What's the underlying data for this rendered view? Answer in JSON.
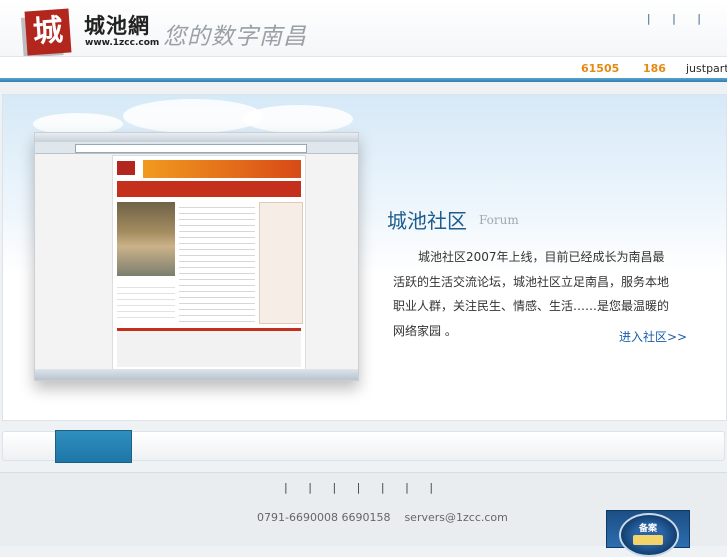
{
  "header": {
    "logo_char": "城",
    "site_name": "城池網",
    "site_url": "www.1zcc.com",
    "slogan": "您的数字南昌",
    "top_links": [
      "|",
      "|",
      "|"
    ]
  },
  "stats": {
    "users": "61505",
    "online": "186",
    "newest_member": "justparty"
  },
  "banner": {
    "title": "城池社区",
    "subtitle": "Forum",
    "description": "城池社区2007年上线，目前已经成长为南昌最活跃的生活交流论坛，城池社区立足南昌，服务本地职业人群，关注民生、情感、生活……是您最温暖的网络家园 。",
    "enter_link": "进入社区>>"
  },
  "footer": {
    "separators": [
      "|",
      "|",
      "|",
      "|",
      "|",
      "|",
      "|"
    ],
    "phone": "0791-6690008 6690158",
    "email": "servers@1zcc.com",
    "badge_text": "备案"
  },
  "colors": {
    "accent_blue": "#2f7fb2",
    "stat_orange": "#e58a12",
    "link_blue": "#1a5ea8",
    "brand_red": "#b3261e"
  }
}
